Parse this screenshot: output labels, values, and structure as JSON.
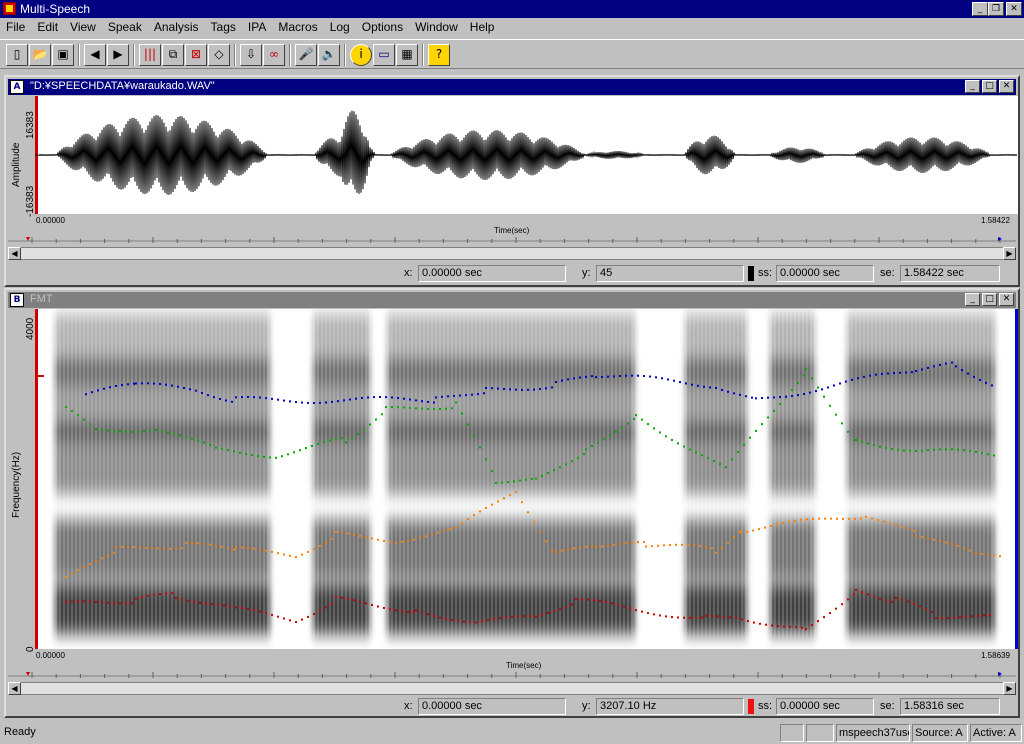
{
  "app": {
    "title": "Multi-Speech"
  },
  "menu": [
    "File",
    "Edit",
    "View",
    "Speak",
    "Analysis",
    "Tags",
    "IPA",
    "Macros",
    "Log",
    "Options",
    "Window",
    "Help"
  ],
  "toolbar_icons": [
    "new-icon",
    "open-icon",
    "save-icon",
    "arrow-left-icon",
    "arrow-right-icon",
    "bars-icon",
    "copy-window-icon",
    "close-window-icon",
    "eraser-icon",
    "download-icon",
    "link-icon",
    "microphone-icon",
    "speaker-icon",
    "info-icon",
    "window-icon",
    "grid-icon",
    "help-icon"
  ],
  "waveform_window": {
    "label": "A",
    "title": "\"D:¥SPEECHDATA¥waraukado.WAV\"",
    "ylabel": "Amplitude",
    "ymax": "16383",
    "ymin": "-16383",
    "xstart": "0.00000",
    "xend": "1.58422",
    "xlabel": "Time(sec)",
    "status": {
      "x_label": "x:",
      "x": "0.00000 sec",
      "y_label": "y:",
      "y": "45",
      "ss_label": "ss:",
      "ss": "0.00000 sec",
      "se_label": "se:",
      "se": "1.58422 sec"
    }
  },
  "spectrogram_window": {
    "label": "B",
    "title": "FMT",
    "ylabel": "Frequency(Hz)",
    "ymax": "4000",
    "ymin": "0",
    "xstart": "0.00000",
    "xend": "1.58639",
    "xlabel": "Time(sec)",
    "status": {
      "x_label": "x:",
      "x": "0.00000 sec",
      "y_label": "y:",
      "y": "3207.10 Hz",
      "ss_label": "ss:",
      "ss": "0.00000 sec",
      "se_label": "se:",
      "se": "1.58316 sec"
    }
  },
  "statusbar": {
    "ready": "Ready",
    "user": "mspeech37use",
    "source": "Source: A",
    "active": "Active: A"
  },
  "colors": {
    "f1": "#cc0000",
    "f2": "#ff8000",
    "f3": "#00aa00",
    "f4": "#0000cc",
    "titlebar": "#000080"
  }
}
